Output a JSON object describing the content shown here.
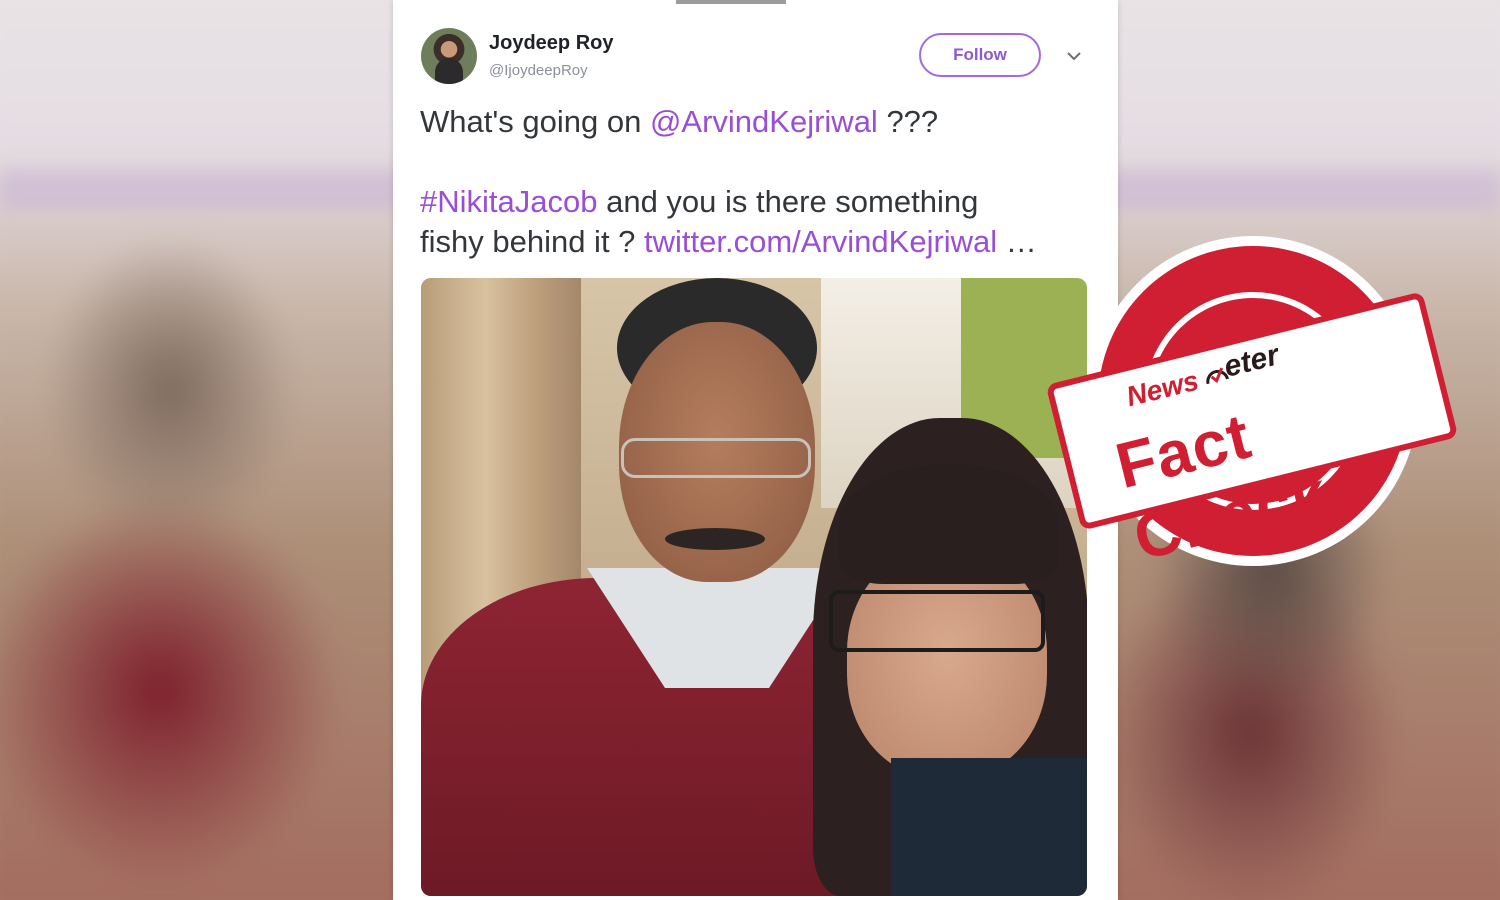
{
  "tweet": {
    "author_name": "Joydeep Roy",
    "author_handle": "@IjoydeepRoy",
    "follow_label": "Follow",
    "line1_prefix": "What's going on ",
    "line1_mention": "@ArvindKejriwal",
    "line1_suffix": " ???",
    "line2_hashtag": "#NikitaJacob",
    "line2_suffix": " and you is there something",
    "line3_prefix": "fishy behind it ? ",
    "line3_link": "twitter.com/ArvindKejriwal",
    "line3_ellipsis": " …"
  },
  "stamp": {
    "brand_part1": "News",
    "brand_part2": "eter",
    "label": "Fact Check"
  },
  "colors": {
    "link": "#9a4ed6",
    "follow_border": "#a26ae0",
    "stamp_red": "#d01f32"
  }
}
